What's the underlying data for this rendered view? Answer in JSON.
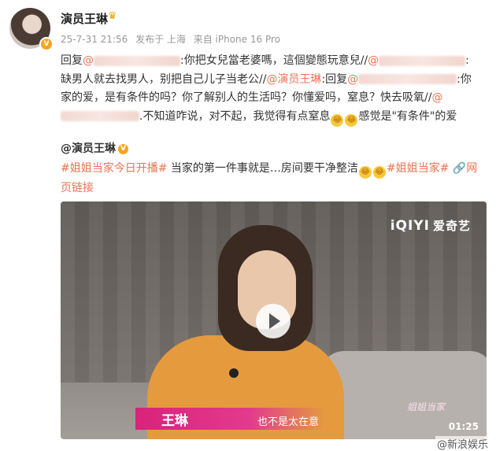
{
  "post": {
    "author": "演员王琳",
    "crown_icon": "crown-icon",
    "verified_icon": "verified-badge-icon",
    "timestamp": "25-7-31 21:56",
    "location_label": "发布于 上海",
    "device_label": "来自 iPhone 16 Pro",
    "content": {
      "t1": "回复",
      "t2": ":你把女兒當老婆嗎，這個變態玩意兒//",
      "t3": ":缺男人就去找男人，别把自己儿子当老公//",
      "mention_author": "@演员王琳",
      "t4": ":回复",
      "t5": ":你家的爱，是有条件的吗？你了解别人的生活吗？你懂爱吗，窒息？快去吸氧//",
      "at_sign": "@",
      "t6": ".不知道咋说，对不起，我觉得有点窒息",
      "t7": "感觉是\"有条件\"的爱"
    },
    "emoji_name": "laugh-cry-emoji"
  },
  "repost": {
    "author": "@演员王琳",
    "hashtag1": "#姐姐当家今日开播#",
    "text": "当家的第一件事就是…房间要干净整洁",
    "hashtag2": "#姐姐当家#",
    "link_label": "网页链接",
    "link_icon": "link-icon"
  },
  "video": {
    "logo_brand": "iQIYI",
    "logo_cn": "爱奇艺",
    "caption_name": "王琳",
    "caption_text": "也不是太在意",
    "watermark": "姐姐当家",
    "duration": "01:25",
    "source": "@新浪娱乐"
  }
}
